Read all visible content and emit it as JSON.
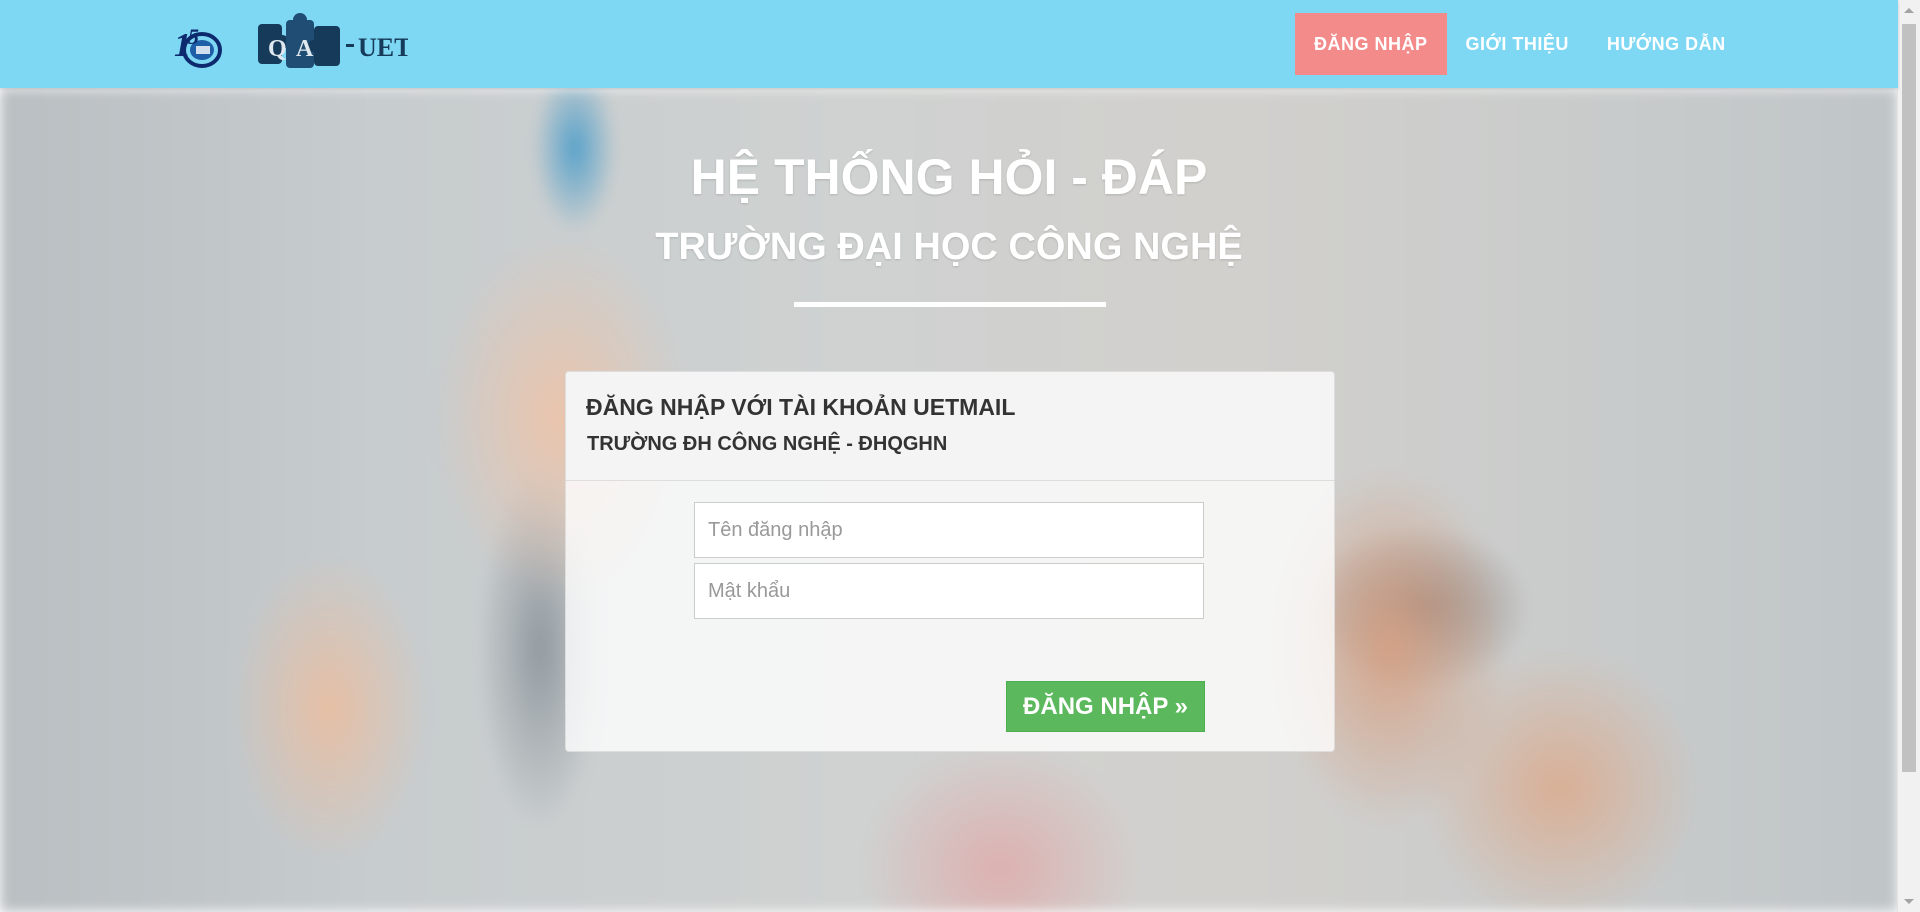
{
  "nav": {
    "logos": {
      "left_icon": "uet-15-years-logo",
      "right_icon": "qa-uet-logo"
    },
    "links": [
      {
        "label": "ĐĂNG NHẬP",
        "active": true
      },
      {
        "label": "GIỚI THIỆU",
        "active": false
      },
      {
        "label": "HƯỚNG DẪN",
        "active": false
      }
    ]
  },
  "hero": {
    "title": "HỆ THỐNG HỎI - ĐÁP",
    "subtitle": "TRƯỜNG ĐẠI HỌC CÔNG NGHỆ"
  },
  "login": {
    "heading": "ĐĂNG NHẬP VỚI TÀI KHOẢN UETMAIL",
    "subheading": "TRƯỜNG ĐH CÔNG NGHỆ - ĐHQGHN",
    "username_placeholder": "Tên đăng nhập",
    "username_value": "",
    "password_placeholder": "Mật khẩu",
    "password_value": "",
    "submit_label": "ĐĂNG NHẬP »"
  },
  "colors": {
    "navbar_bg": "#7fd8f3",
    "nav_active_bg": "#f48b8b",
    "submit_bg": "#5cb85c"
  }
}
